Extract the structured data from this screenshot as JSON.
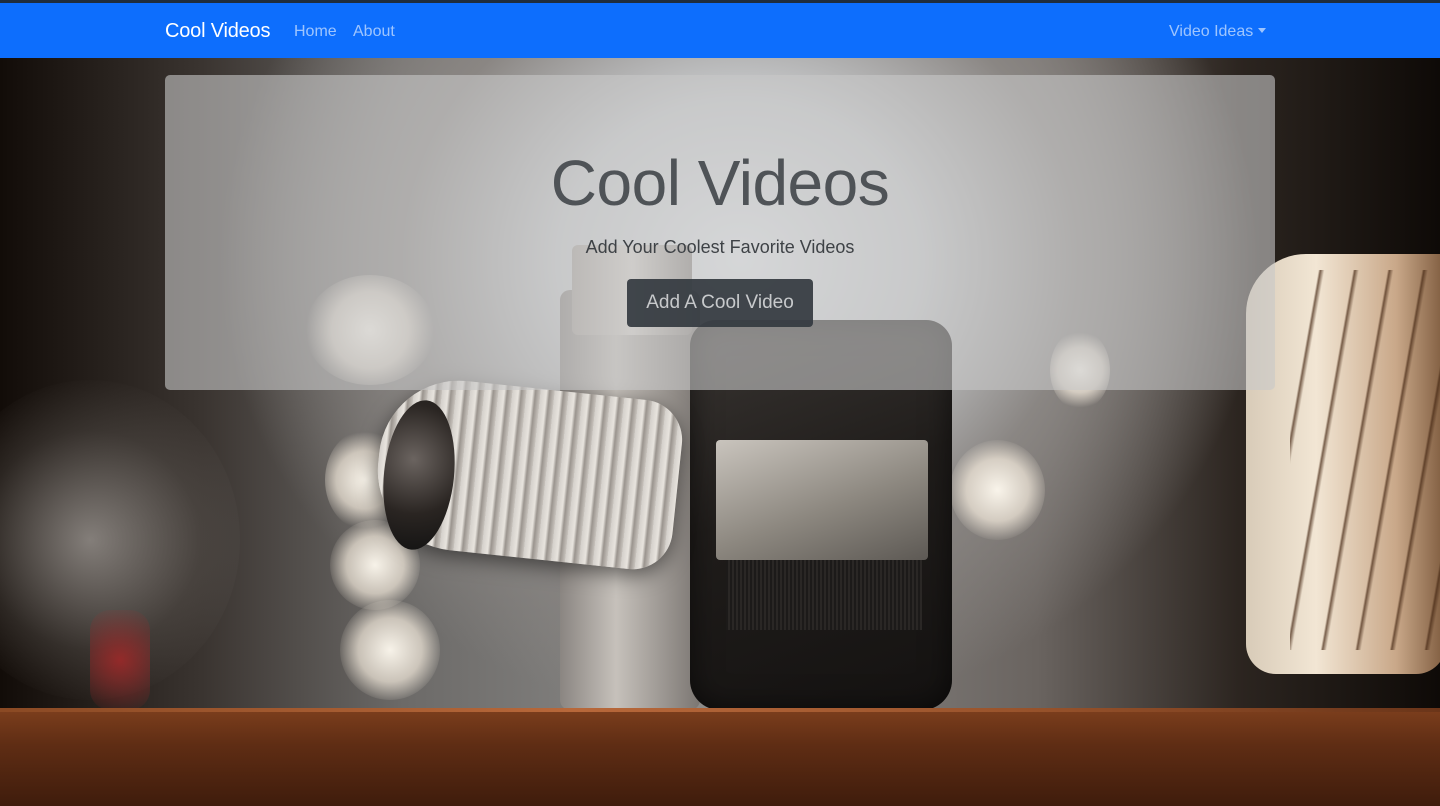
{
  "navbar": {
    "brand": "Cool Videos",
    "links": [
      {
        "label": "Home"
      },
      {
        "label": "About"
      }
    ],
    "dropdown": {
      "label": "Video Ideas",
      "icon": "caret-down-icon"
    },
    "color": "#0d6efd"
  },
  "hero": {
    "title": "Cool Videos",
    "lead": "Add Your Coolest Favorite Videos",
    "cta_label": "Add A Cool Video"
  }
}
